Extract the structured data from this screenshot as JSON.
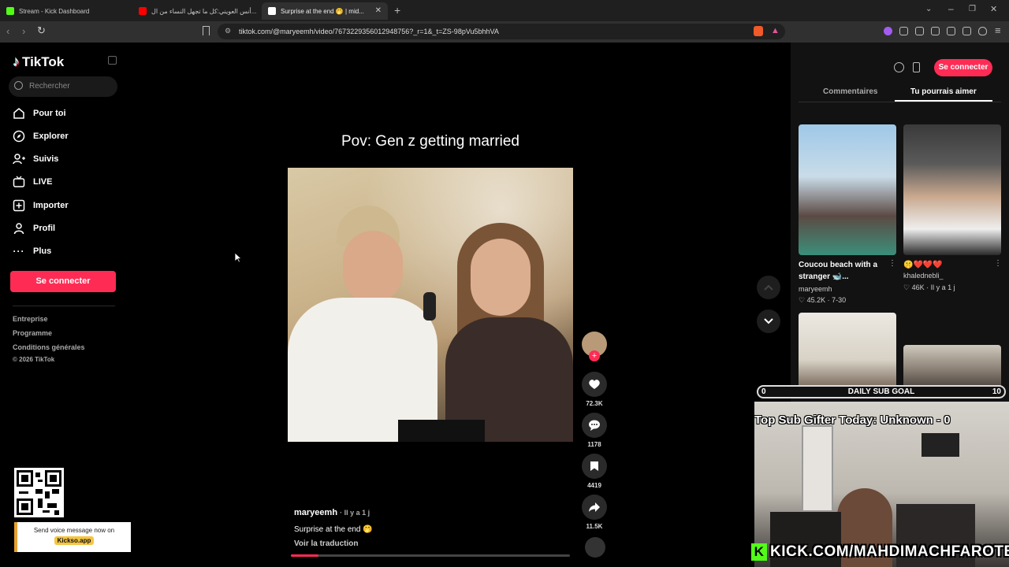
{
  "browser": {
    "tabs": [
      {
        "title": "Stream - Kick Dashboard",
        "fav_color": "#53fc18"
      },
      {
        "title": "أنس العويني:كل ما تجهل النساء من ال...",
        "fav_color": "#ff0000"
      },
      {
        "title": "Surprise at the end 🤭 | mid...",
        "fav_color": "#ffffff"
      }
    ],
    "url": "tiktok.com/@maryeemh/video/7673229356012948756?_r=1&_t=ZS-98pVu5bhhVA"
  },
  "sidebar": {
    "logo": "TikTok",
    "search_placeholder": "Rechercher",
    "items": [
      {
        "label": "Pour toi",
        "icon": "home-icon"
      },
      {
        "label": "Explorer",
        "icon": "compass-icon"
      },
      {
        "label": "Suivis",
        "icon": "following-icon"
      },
      {
        "label": "LIVE",
        "icon": "live-icon"
      },
      {
        "label": "Importer",
        "icon": "upload-icon"
      },
      {
        "label": "Profil",
        "icon": "profile-icon"
      },
      {
        "label": "Plus",
        "icon": "more-icon"
      }
    ],
    "login_label": "Se connecter",
    "footer": [
      "Entreprise",
      "Programme",
      "Conditions générales",
      "© 2026 TikTok"
    ]
  },
  "video": {
    "title": "Pov: Gen z getting married",
    "author": "maryeemh",
    "time": "· Il y a 1 j",
    "caption": "Surprise at the end 🤭",
    "translate": "Voir la traduction",
    "progress": 0.1,
    "actions": {
      "likes": "72.3K",
      "comments": "1178",
      "saves": "4419",
      "shares": "11.5K"
    }
  },
  "right_panel": {
    "login_label": "Se connecter",
    "tabs": [
      "Commentaires",
      "Tu pourrais aimer"
    ],
    "items": [
      {
        "title": "Coucou beach with a stranger 🐋...",
        "author": "maryeemh",
        "likes": "45.2K",
        "date": "7-30"
      },
      {
        "title": "🤫❤️❤️❤️",
        "author": "khalednebli_",
        "likes": "46K",
        "date": "Il y a 1 j"
      }
    ]
  },
  "overlay": {
    "goal_left": "0",
    "goal_label": "DAILY SUB GOAL",
    "goal_right": "10",
    "gifter": "Top Sub Gifter Today: Unknown - 0",
    "kick_url": "KICK.COM/MAHDIMACHFAROTB",
    "kickso_text": "Send voice message now on",
    "kickso_brand": "Kickso.app"
  }
}
